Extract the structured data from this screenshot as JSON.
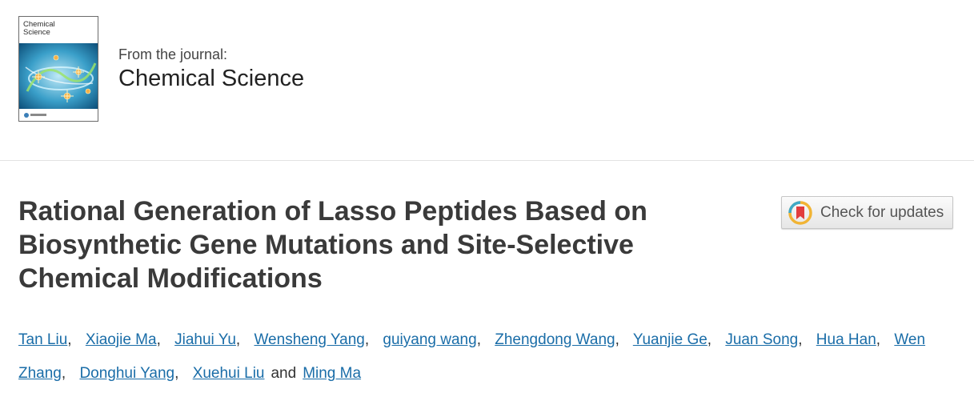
{
  "journal": {
    "cover_line1": "Chemical",
    "cover_line2": "Science",
    "from_label": "From the journal:",
    "name": "Chemical Science"
  },
  "article": {
    "title_line1": "Rational Generation of Lasso Peptides Based on",
    "title_line2": "Biosynthetic Gene Mutations and Site-Selective",
    "title_line3": "Chemical Modifications"
  },
  "check_updates": {
    "label": "Check for updates"
  },
  "authors": {
    "list": [
      "Tan Liu",
      "Xiaojie Ma",
      "Jiahui Yu",
      "Wensheng Yang",
      "guiyang wang",
      "Zhengdong Wang",
      "Yuanjie Ge",
      "Juan Song",
      "Hua Han",
      "Wen Zhang",
      "Donghui Yang",
      "Xuehui Liu",
      "Ming Ma"
    ],
    "comma": ",",
    "and_word": "and"
  },
  "colors": {
    "link": "#1a6da8",
    "title": "#3a3a3a",
    "divider": "#e2e2e2"
  }
}
